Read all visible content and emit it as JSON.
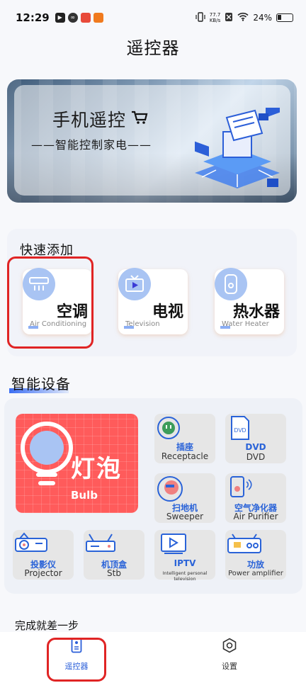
{
  "status_bar": {
    "time": "12:29",
    "net_speed_value": "77.7",
    "net_speed_unit": "KB/s",
    "battery": "24%"
  },
  "page": {
    "title": "遥控器"
  },
  "banner": {
    "title": "手机遥控",
    "subtitle": "——智能控制家电——"
  },
  "quick_add": {
    "heading": "快速添加",
    "items": [
      {
        "zh": "空调",
        "en": "Air Conditioning"
      },
      {
        "zh": "电视",
        "en": "Television"
      },
      {
        "zh": "热水器",
        "en": "Water Heater"
      }
    ]
  },
  "smart_devices": {
    "heading": "智能设备",
    "bulb": {
      "zh": "灯泡",
      "en": "Bulb"
    },
    "tiles": [
      {
        "zh": "插座",
        "en": "Receptacle"
      },
      {
        "zh": "DVD",
        "en": "DVD"
      },
      {
        "zh": "扫地机",
        "en": "Sweeper"
      },
      {
        "zh": "空气净化器",
        "en": "Air Purifier"
      },
      {
        "zh": "投影仪",
        "en": "Projector"
      },
      {
        "zh": "机顶盒",
        "en": "Stb"
      },
      {
        "zh": "IPTV",
        "en": "Intelligent personal television"
      },
      {
        "zh": "功放",
        "en": "Power amplifier"
      }
    ]
  },
  "next_step": {
    "label": "完成就差一步"
  },
  "bottom_nav": {
    "remote_label": "遥控器",
    "settings_label": "设置"
  },
  "colors": {
    "accent": "#2b5fd9",
    "highlight": "#e02424",
    "bulb_tile": "#ff5b5b"
  }
}
